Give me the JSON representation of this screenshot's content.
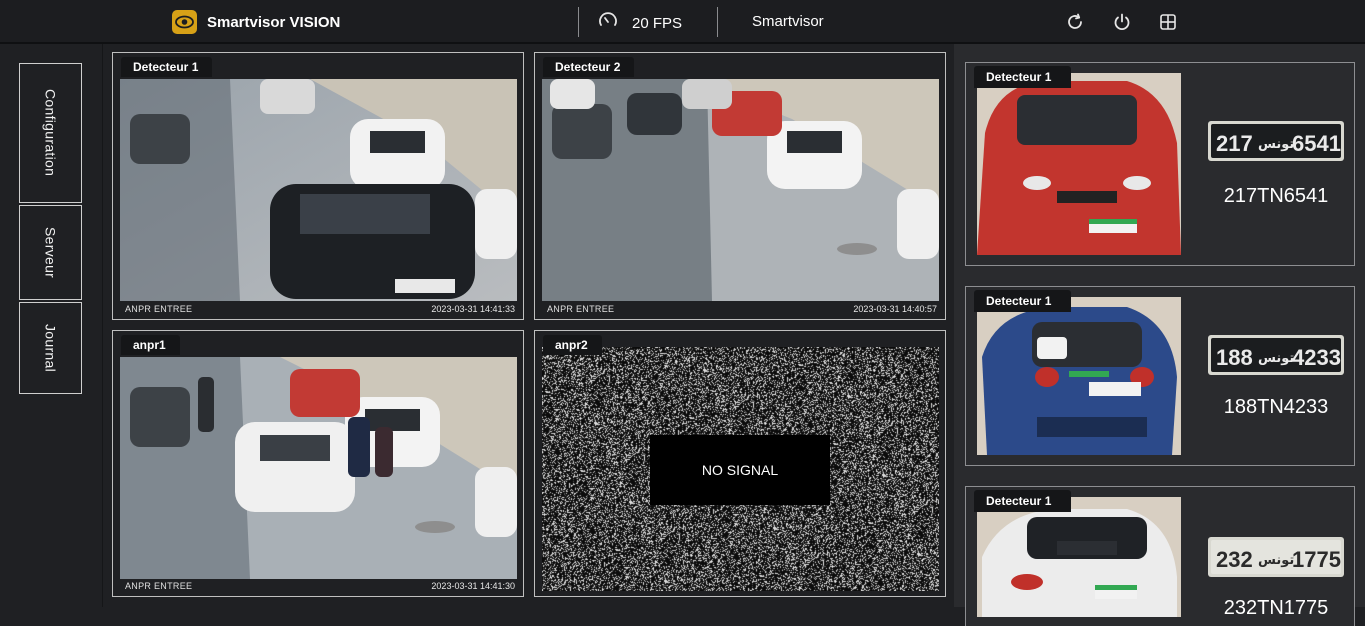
{
  "header": {
    "app_name": "Smartvisor VISION",
    "fps": "20 FPS",
    "server": "Smartvisor"
  },
  "sidebar": {
    "items": [
      {
        "label": "Configuration"
      },
      {
        "label": "Serveur"
      },
      {
        "label": "Journal"
      }
    ]
  },
  "cameras": [
    {
      "label": "Detecteur 1",
      "location": "ANPR ENTREE",
      "timestamp": "2023-03-31 14:41:33"
    },
    {
      "label": "Detecteur 2",
      "location": "ANPR ENTREE",
      "timestamp": "2023-03-31 14:40:57"
    },
    {
      "label": "anpr1",
      "location": "ANPR ENTREE",
      "timestamp": "2023-03-31 14:41:30"
    },
    {
      "label": "anpr2",
      "status": "NO SIGNAL"
    }
  ],
  "detections": [
    {
      "label": "Detecteur 1",
      "plate": "217TN6541",
      "car_color": "#c2352e",
      "plate_left": "217",
      "plate_right": "6541",
      "plate_mid": "تونس"
    },
    {
      "label": "Detecteur 1",
      "plate": "188TN4233",
      "car_color": "#2c4a8a",
      "plate_left": "188",
      "plate_right": "4233",
      "plate_mid": "تونس"
    },
    {
      "label": "Detecteur 1",
      "plate": "232TN1775",
      "car_color": "#e8e8e8",
      "plate_left": "232",
      "plate_right": "1775",
      "plate_mid": "تونس"
    }
  ],
  "icons": {
    "logo": "eye-icon",
    "fps": "speedometer-icon",
    "refresh": "refresh-icon",
    "power": "power-icon",
    "layout": "grid-icon"
  }
}
